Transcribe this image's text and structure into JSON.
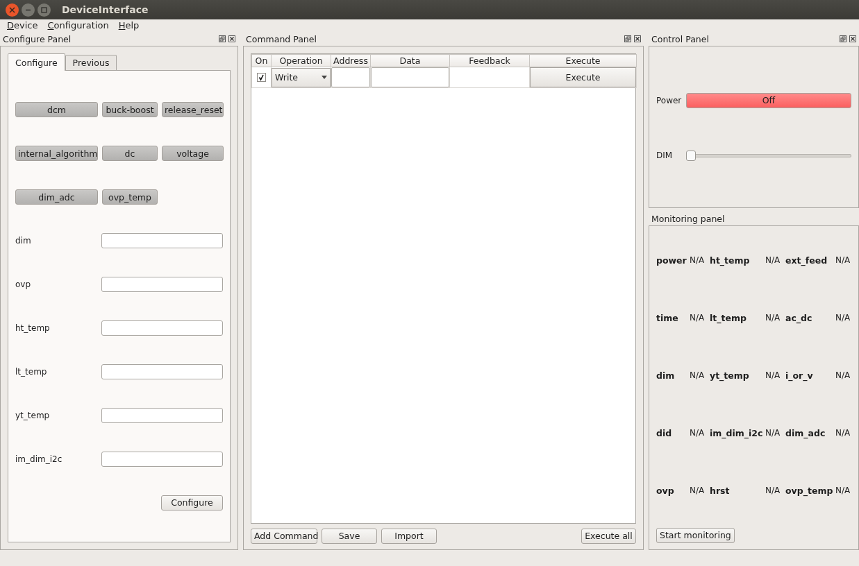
{
  "window": {
    "title": "DeviceInterface"
  },
  "menu": [
    {
      "label": "Device"
    },
    {
      "label": "Configuration"
    },
    {
      "label": "Help"
    }
  ],
  "configure_panel": {
    "title": "Configure Panel",
    "tabs": [
      {
        "label": "Configure",
        "selected": true
      },
      {
        "label": "Previous",
        "selected": false
      }
    ],
    "buttons": [
      [
        "dcm",
        "buck-boost",
        "release_reset"
      ],
      [
        "internal_algorithm",
        "dc",
        "voltage"
      ],
      [
        "dim_adc",
        "ovp_temp"
      ]
    ],
    "fields": [
      {
        "label": "dim"
      },
      {
        "label": "ovp"
      },
      {
        "label": "ht_temp"
      },
      {
        "label": "lt_temp"
      },
      {
        "label": "yt_temp"
      },
      {
        "label": "im_dim_i2c"
      }
    ],
    "submit": "Configure"
  },
  "command_panel": {
    "title": "Command Panel",
    "columns": [
      "On",
      "Operation",
      "Address",
      "Data",
      "Feedback",
      "Execute"
    ],
    "rows": [
      {
        "on": true,
        "operation": "Write",
        "execute": "Execute"
      }
    ],
    "buttons": [
      "Add Command",
      "Save",
      "Import"
    ],
    "execute_all": "Execute all"
  },
  "control_panel": {
    "title": "Control Panel",
    "power": {
      "label": "Power",
      "button": "Off",
      "on": false
    },
    "dim": {
      "label": "DIM",
      "level": 0
    }
  },
  "monitoring_panel": {
    "title": "Monitoring panel",
    "rows": [
      [
        {
          "name": "power",
          "value": "N/A"
        },
        {
          "name": "ht_temp",
          "value": "N/A"
        },
        {
          "name": "ext_feed",
          "value": "N/A"
        }
      ],
      [
        {
          "name": "time",
          "value": "N/A"
        },
        {
          "name": "lt_temp",
          "value": "N/A"
        },
        {
          "name": "ac_dc",
          "value": "N/A"
        }
      ],
      [
        {
          "name": "dim",
          "value": "N/A"
        },
        {
          "name": "yt_temp",
          "value": "N/A"
        },
        {
          "name": "i_or_v",
          "value": "N/A"
        }
      ],
      [
        {
          "name": "did",
          "value": "N/A"
        },
        {
          "name": "im_dim_i2c",
          "value": "N/A"
        },
        {
          "name": "dim_adc",
          "value": "N/A"
        }
      ],
      [
        {
          "name": "ovp",
          "value": "N/A"
        },
        {
          "name": "hrst",
          "value": "N/A"
        },
        {
          "name": "ovp_temp",
          "value": "N/A"
        }
      ]
    ],
    "start": "Start monitoring"
  }
}
